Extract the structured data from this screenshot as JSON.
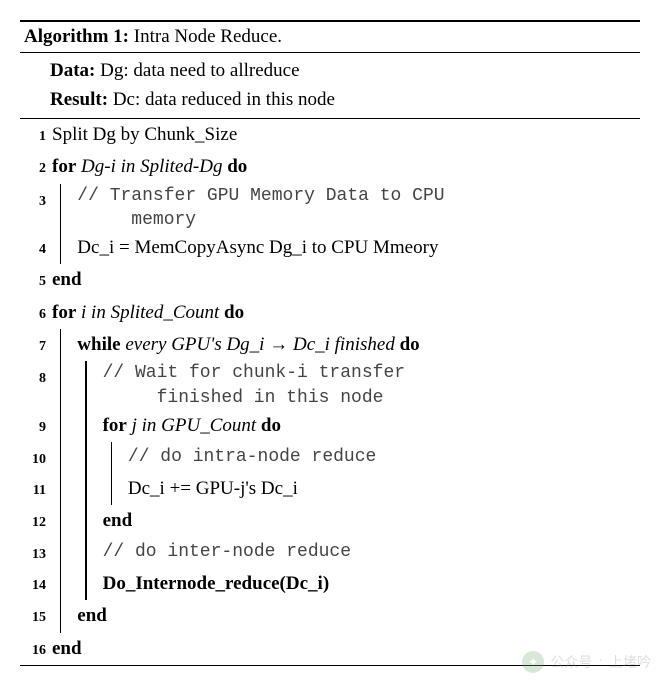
{
  "algo": {
    "header_label": "Algorithm 1:",
    "header_title": "Intra Node Reduce.",
    "data_label": "Data:",
    "data_text": "Dg: data need to allreduce",
    "result_label": "Result:",
    "result_text": "Dc: data reduced in this node"
  },
  "lines": {
    "l1": "Split Dg by Chunk_Size",
    "l2_for": "for",
    "l2_cond": "Dg-i in Splited-Dg",
    "l2_do": "do",
    "l3a": "// Transfer GPU Memory Data to CPU",
    "l3b": "memory",
    "l4": "Dc_i = MemCopyAsync Dg_i to CPU Mmeory",
    "l5": "end",
    "l6_for": "for",
    "l6_cond": "i in Splited_Count",
    "l6_do": "do",
    "l7_while": "while",
    "l7_cond_a": "every GPU's Dg_i",
    "l7_arrow": "→",
    "l7_cond_b": "Dc_i finished",
    "l7_do": "do",
    "l8a": "// Wait for chunk-i transfer",
    "l8b": "finished in this node",
    "l9_for": "for",
    "l9_cond": "j in GPU_Count",
    "l9_do": "do",
    "l10": "// do intra-node reduce",
    "l11": "Dc_i += GPU-j's Dc_i",
    "l12": "end",
    "l13": "// do inter-node reduce",
    "l14": "Do_Internode_reduce(Dc_i)",
    "l15": "end",
    "l16": "end"
  },
  "watermark": {
    "label": "公众号",
    "name": "上堵吟"
  }
}
